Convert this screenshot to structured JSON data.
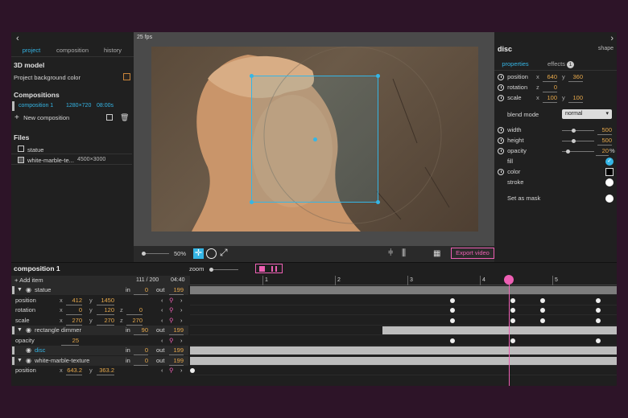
{
  "left_panel": {
    "back_icon": "chevron-left-icon",
    "tabs": [
      "project",
      "composition",
      "history"
    ],
    "model_title": "3D model",
    "bg_color_label": "Project background color",
    "compositions_title": "Compositions",
    "composition": {
      "name": "composition 1",
      "size": "1280×720",
      "duration": "08:00s"
    },
    "new_composition": "New composition",
    "files_title": "Files",
    "files": [
      {
        "name": "statue",
        "icon": "cube-icon",
        "meta": ""
      },
      {
        "name": "white-marble-te...",
        "icon": "image-icon",
        "meta": "4500×3000"
      }
    ]
  },
  "viewport": {
    "fps": "25 fps",
    "zoom": "50",
    "zoom_unit": "%",
    "export_label": "Export video"
  },
  "right_panel": {
    "title": "disc",
    "subtitle": "shape",
    "tabs": [
      "properties",
      "effects"
    ],
    "effects_count": "1",
    "position": {
      "label": "position",
      "x": "640",
      "y": "360"
    },
    "rotation": {
      "label": "rotation",
      "z": "0"
    },
    "scale": {
      "label": "scale",
      "x": "100",
      "y": "100"
    },
    "blend_label": "blend mode",
    "blend_value": "normal",
    "width": {
      "label": "width",
      "value": "500"
    },
    "height": {
      "label": "height",
      "value": "500"
    },
    "opacity": {
      "label": "opacity",
      "value": "20",
      "unit": "%"
    },
    "fill_label": "fill",
    "color_label": "color",
    "stroke_label": "stroke",
    "mask_label": "Set as mask",
    "accent": "#35b6e6"
  },
  "timeline": {
    "title": "composition 1",
    "zoom_label": "zoom",
    "add_item": "Add item",
    "frame": "111 / 200",
    "time": "04:40",
    "ruler": [
      "1",
      "2",
      "3",
      "4",
      "5"
    ],
    "playhead_color": "#ee5fb4",
    "rows": [
      {
        "type": "layer",
        "name": "statue",
        "in": "0",
        "out": "199"
      },
      {
        "type": "prop",
        "name": "position",
        "x": "412",
        "y": "1450"
      },
      {
        "type": "prop",
        "name": "rotation",
        "x": "0",
        "y": "120",
        "z": "0"
      },
      {
        "type": "prop",
        "name": "scale",
        "x": "270",
        "y": "270",
        "z": "270"
      },
      {
        "type": "layer",
        "name": "rectangle dimmer",
        "in": "90",
        "out": "199"
      },
      {
        "type": "prop",
        "name": "opacity",
        "value": "25"
      },
      {
        "type": "layer",
        "name": "disc",
        "in": "0",
        "out": "199"
      },
      {
        "type": "layer",
        "name": "white-marble-texture",
        "in": "0",
        "out": "199"
      },
      {
        "type": "prop",
        "name": "position",
        "x": "643.2",
        "y": "363.2"
      }
    ],
    "labels": {
      "in": "in",
      "out": "out",
      "x": "x",
      "y": "y",
      "z": "z"
    }
  }
}
